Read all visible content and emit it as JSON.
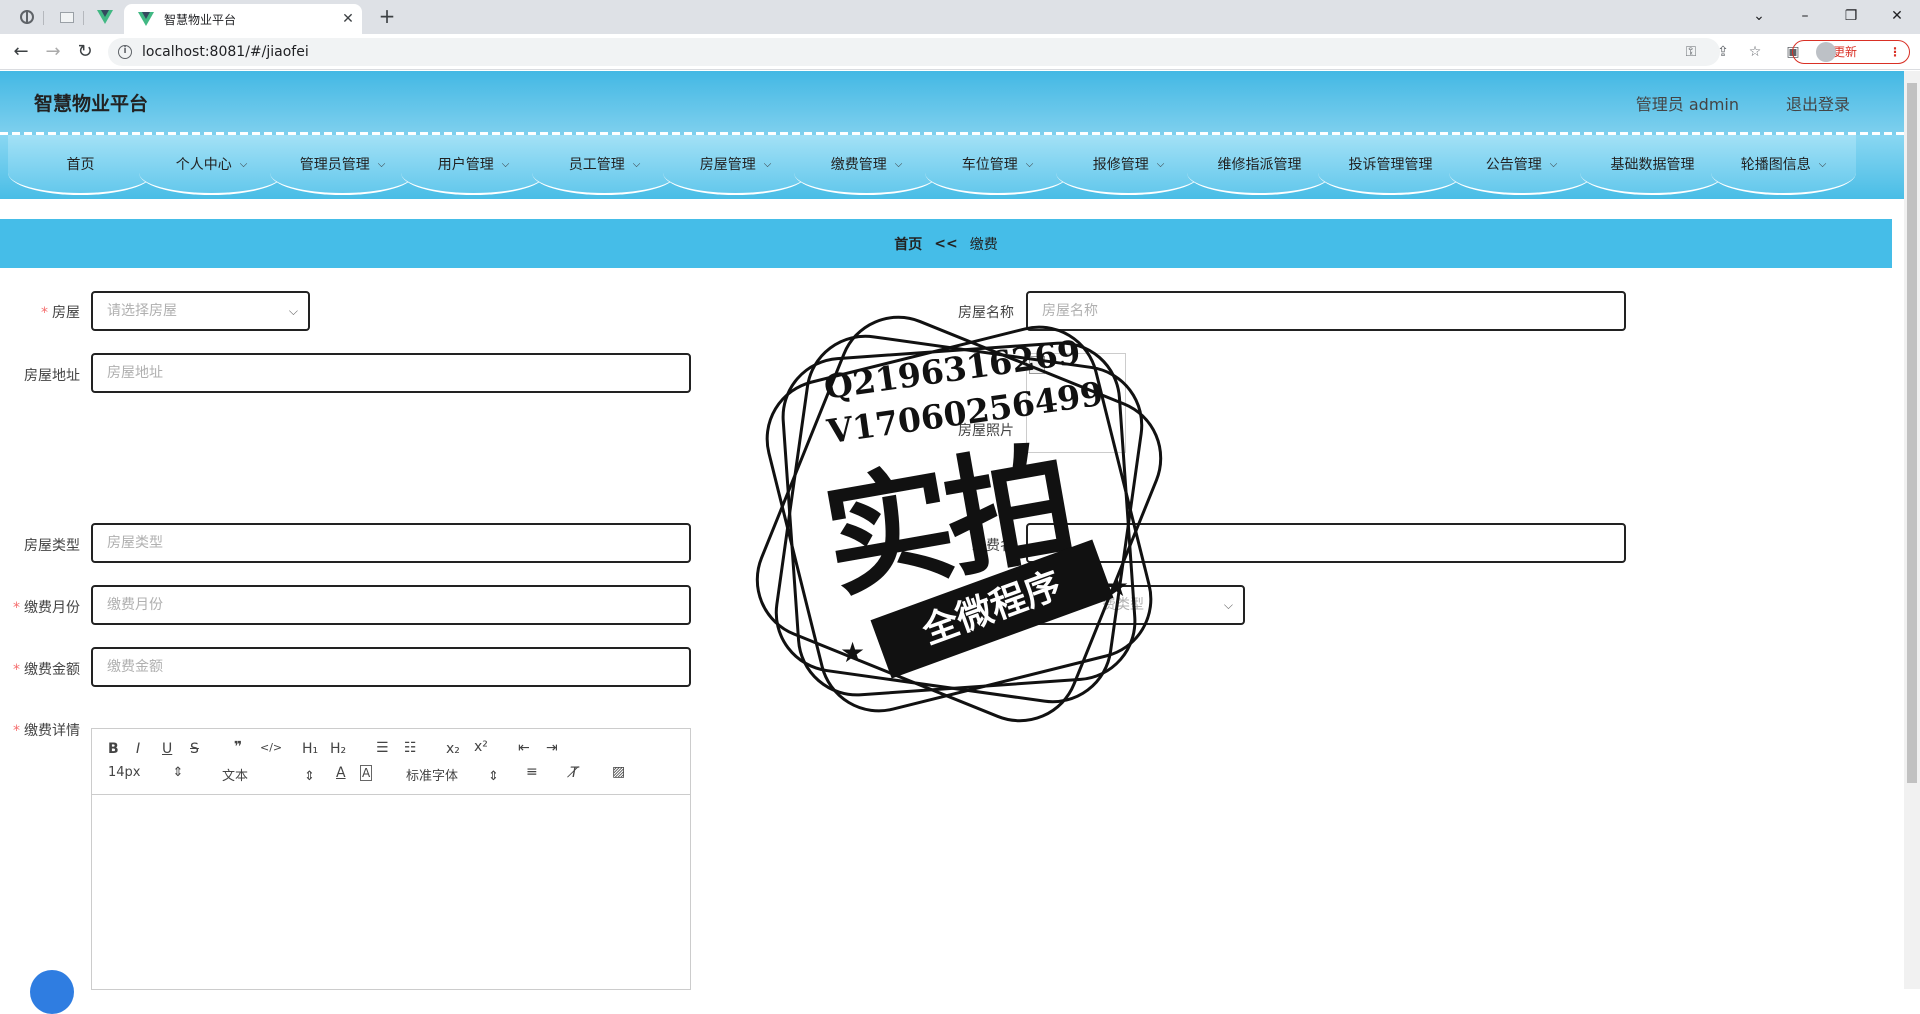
{
  "browser": {
    "tab_title": "智慧物业平台",
    "url": "localhost:8081/#/jiaofei",
    "update_label": "更新"
  },
  "header": {
    "title": "智慧物业平台",
    "user": "管理员 admin",
    "logout": "退出登录"
  },
  "nav": [
    {
      "label": "首页",
      "chevron": false
    },
    {
      "label": "个人中心",
      "chevron": true
    },
    {
      "label": "管理员管理",
      "chevron": true
    },
    {
      "label": "用户管理",
      "chevron": true
    },
    {
      "label": "员工管理",
      "chevron": true
    },
    {
      "label": "房屋管理",
      "chevron": true
    },
    {
      "label": "缴费管理",
      "chevron": true
    },
    {
      "label": "车位管理",
      "chevron": true
    },
    {
      "label": "报修管理",
      "chevron": true
    },
    {
      "label": "维修指派管理",
      "chevron": false
    },
    {
      "label": "投诉管理管理",
      "chevron": false
    },
    {
      "label": "公告管理",
      "chevron": true
    },
    {
      "label": "基础数据管理",
      "chevron": false
    },
    {
      "label": "轮播图信息",
      "chevron": true
    }
  ],
  "breadcrumb": {
    "home": "首页",
    "sep": "<<",
    "current": "缴费"
  },
  "form": {
    "house_label": "房屋",
    "house_placeholder": "请选择房屋",
    "house_name_label": "房屋名称",
    "house_name_placeholder": "房屋名称",
    "house_address_label": "房屋地址",
    "house_address_placeholder": "房屋地址",
    "house_photo_label": "房屋照片",
    "house_type_label": "房屋类型",
    "house_type_placeholder": "房屋类型",
    "fee_name_label": "缴费名",
    "fee_month_label": "缴费月份",
    "fee_month_placeholder": "缴费月份",
    "fee_type_placeholder": "费类型",
    "fee_amount_label": "缴费金额",
    "fee_amount_placeholder": "缴费金额",
    "fee_detail_label": "缴费详情"
  },
  "editor": {
    "font_size": "14px",
    "text_style": "文本",
    "font_family": "标准字体"
  },
  "stamp": {
    "line1": "Q2196316269",
    "line2": "V17060256499",
    "big": "实拍",
    "ribbon": "全微程序"
  }
}
